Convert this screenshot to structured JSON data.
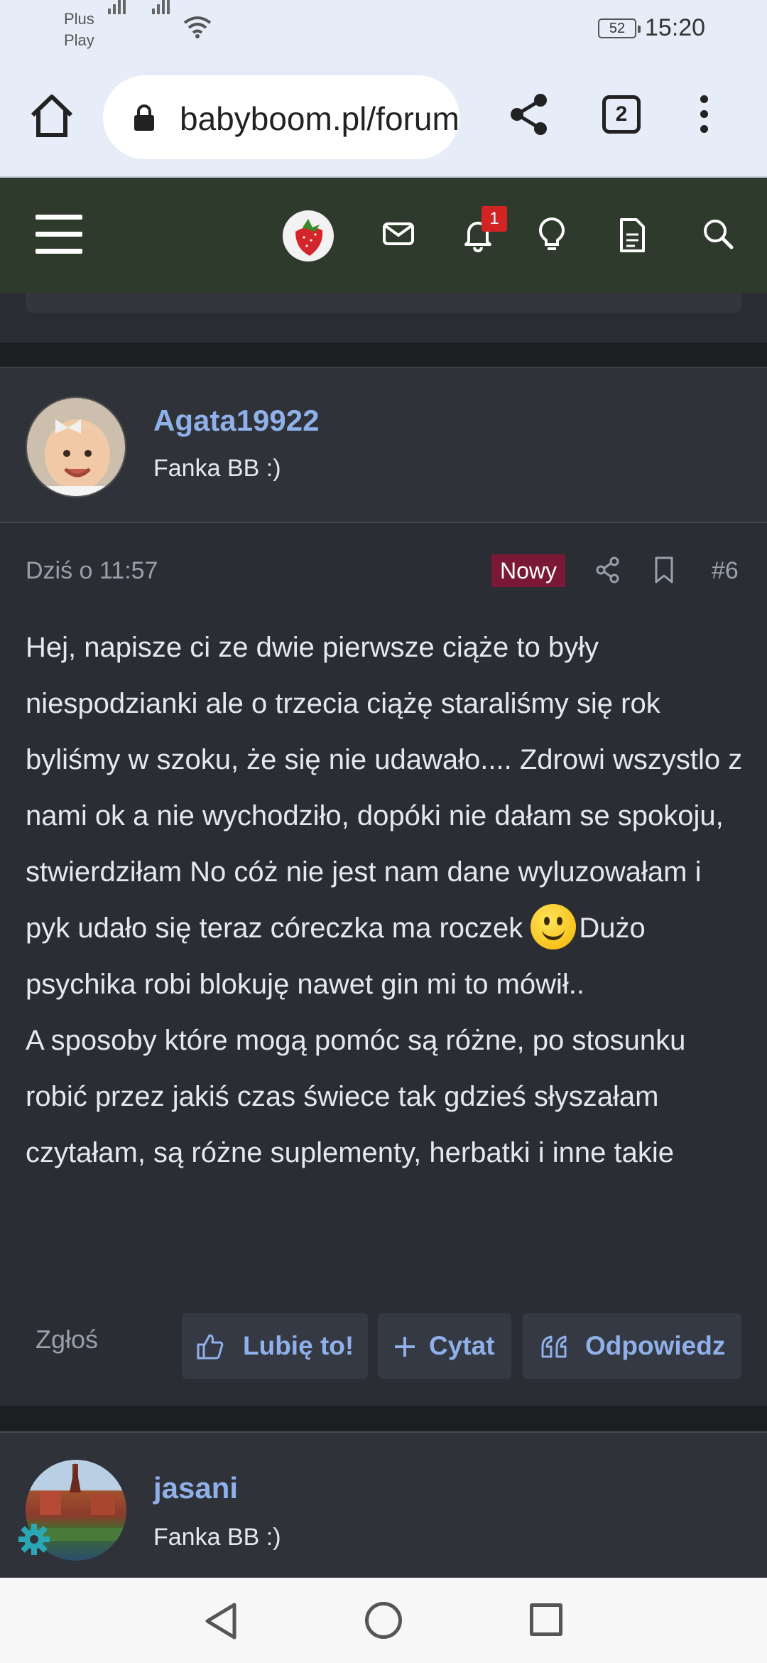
{
  "status_bar": {
    "carrier_1": "Plus",
    "carrier_2": "Play",
    "battery": "52",
    "time": "15:20"
  },
  "browser": {
    "url": "babyboom.pl/forum",
    "tab_count": "2",
    "icons": [
      "home-icon",
      "lock-icon",
      "share-icon",
      "tabs-icon",
      "more-vert-icon"
    ]
  },
  "site_header": {
    "notification_count": "1",
    "icons": [
      "menu-icon",
      "strawberry-logo",
      "mail-icon",
      "bell-icon",
      "lightbulb-icon",
      "document-icon",
      "search-icon"
    ],
    "background": "#2e3a2b"
  },
  "post": {
    "username": "Agata19922",
    "user_title": "Fanka BB :)",
    "date": "Dziś o 11:57",
    "new_label": "Nowy",
    "post_number": "#6",
    "paragraph_1_before_emoji": "Hej, napisze ci ze dwie pierwsze ciąże to były niespodzianki ale o trzecia ciążę staraliśmy się rok byliśmy w szoku, że się nie udawało.... Zdrowi wszystlo z nami ok a nie wychodziło, dopóki nie dałam se spokoju, stwierdziłam No cóż nie jest nam dane wyluzowałam i pyk udało się teraz córeczka ma roczek",
    "paragraph_1_after_emoji": "Dużo psychika robi blokuję nawet gin mi to mówił..",
    "paragraph_2": "A sposoby które mogą pomóc są różne, po stosunku robić przez jakiś czas świece tak gdzieś słyszałam czytałam, są różne suplementy, herbatki i inne takie",
    "actions": {
      "report": "Zgłoś",
      "like": "Lubię to!",
      "quote": "Cytat",
      "reply": "Odpowiedz"
    }
  },
  "next_post": {
    "username": "jasani",
    "user_title": "Fanka BB :)"
  },
  "colors": {
    "link": "#8fb0e8",
    "new_badge": "#7a1836",
    "notification_badge": "#d32424"
  }
}
